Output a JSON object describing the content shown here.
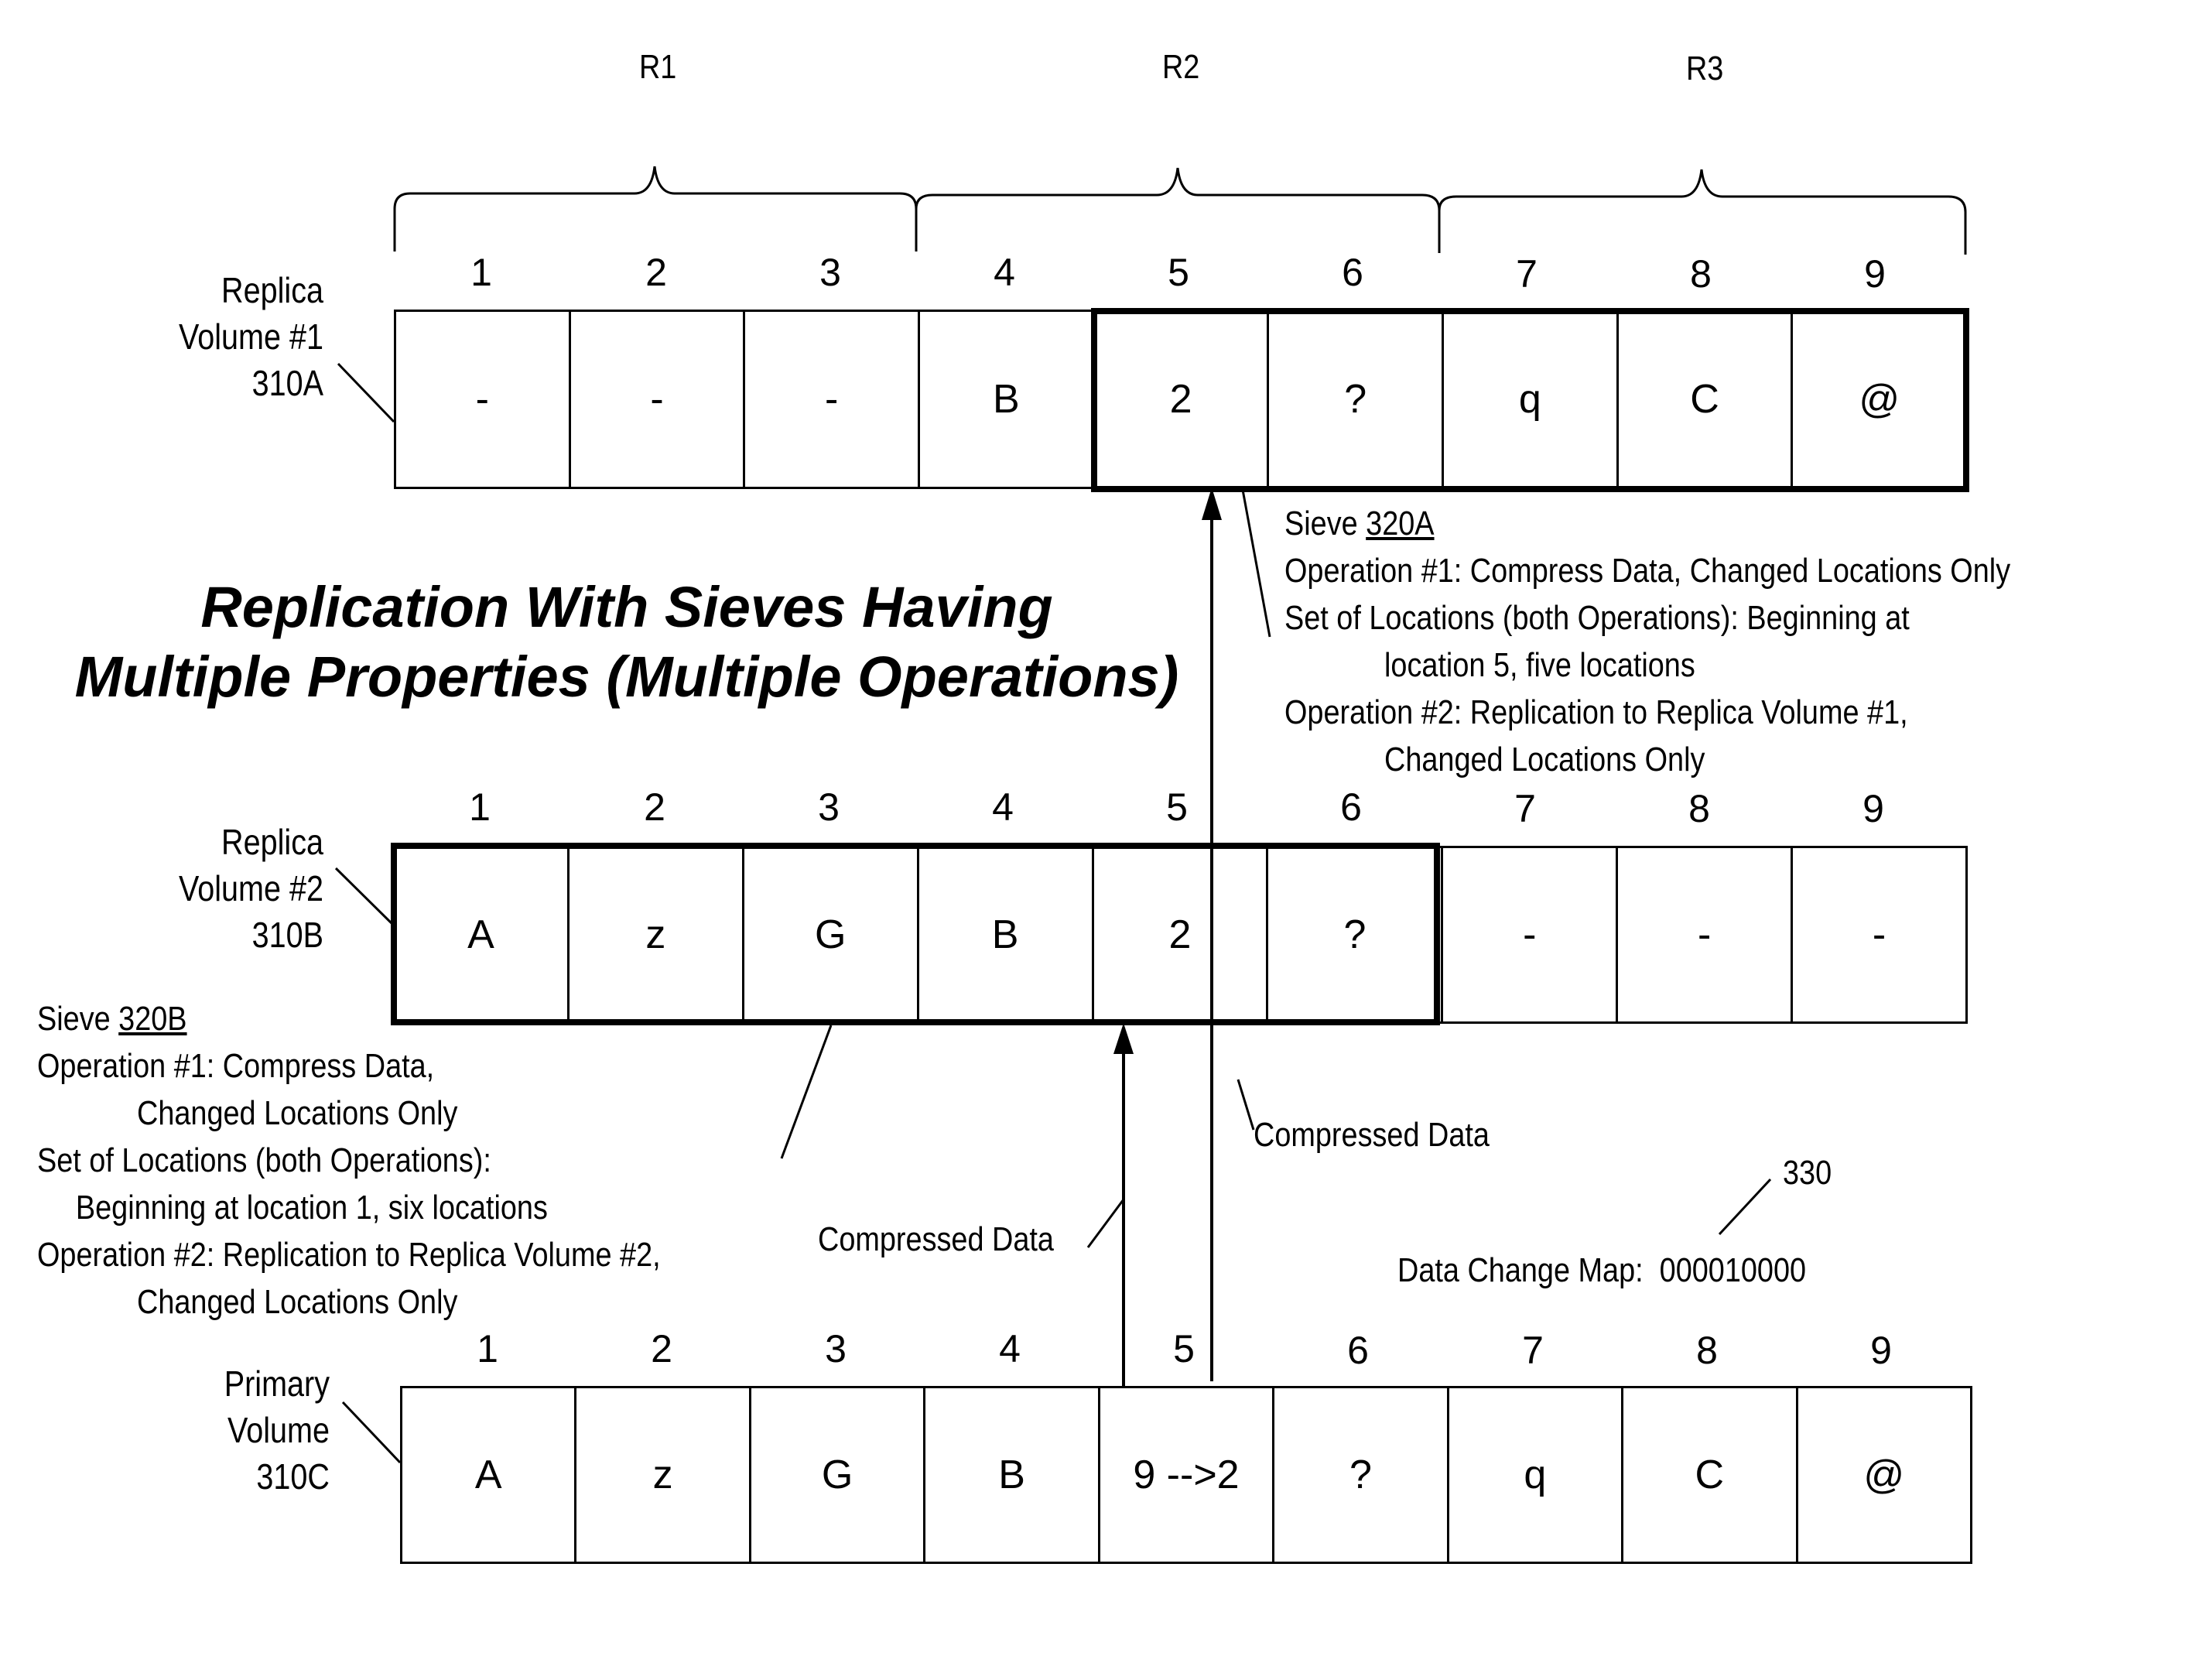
{
  "title": {
    "line1": "Replication With Sieves Having",
    "line2": "Multiple Properties (Multiple Operations)"
  },
  "regions": [
    {
      "label": "R1",
      "locations": [
        1,
        2,
        3
      ]
    },
    {
      "label": "R2",
      "locations": [
        4,
        5,
        6
      ]
    },
    {
      "label": "R3",
      "locations": [
        7,
        8,
        9
      ]
    }
  ],
  "volumes": {
    "replica1": {
      "label_line1": "Replica",
      "label_line2": "Volume #1",
      "label_line3": "310A",
      "column_numbers": [
        "1",
        "2",
        "3",
        "4",
        "5",
        "6",
        "7",
        "8",
        "9"
      ],
      "cells": [
        "-",
        "-",
        "-",
        "B",
        "2",
        "?",
        "q",
        "C",
        "@"
      ],
      "sieve_range": {
        "start": 5,
        "count": 5
      }
    },
    "replica2": {
      "label_line1": "Replica",
      "label_line2": "Volume  #2",
      "label_line3": "310B",
      "column_numbers": [
        "1",
        "2",
        "3",
        "4",
        "5",
        "6",
        "7",
        "8",
        "9"
      ],
      "cells": [
        "A",
        "z",
        "G",
        "B",
        "2",
        "?",
        "-",
        "-",
        "-"
      ],
      "sieve_range": {
        "start": 1,
        "count": 6
      }
    },
    "primary": {
      "label_line1": "Primary",
      "label_line2": "Volume",
      "label_line3": "310C",
      "column_numbers": [
        "1",
        "2",
        "3",
        "4",
        "5",
        "6",
        "7",
        "8",
        "9"
      ],
      "cells": [
        "A",
        "z",
        "G",
        "B",
        "9 -->2",
        "?",
        "q",
        "C",
        "@"
      ]
    }
  },
  "sieve_a": {
    "name_prefix": "Sieve ",
    "name_ref": "320A",
    "op1": "Operation #1:  Compress Data, Changed Locations Only",
    "set_line1": "Set of Locations (both Operations):  Beginning at",
    "set_line2": "location 5, five locations",
    "op2_line1": "Operation #2:  Replication to Replica Volume #1,",
    "op2_line2": "Changed Locations Only"
  },
  "sieve_b": {
    "name_prefix": "Sieve ",
    "name_ref": "320B",
    "op1_line1": "Operation #1:  Compress Data,",
    "op1_line2": "Changed Locations Only",
    "set_line1": "Set of Locations (both Operations):",
    "set_line2": "Beginning at location 1, six locations",
    "op2_line1": "Operation #2:  Replication to Replica Volume #2,",
    "op2_line2": "Changed Locations Only"
  },
  "arrows": {
    "to_replica2_label": "Compressed Data",
    "to_replica1_label": "Compressed Data"
  },
  "data_change_map": {
    "ref": "330",
    "label": "Data Change Map:",
    "value": "000010000"
  }
}
